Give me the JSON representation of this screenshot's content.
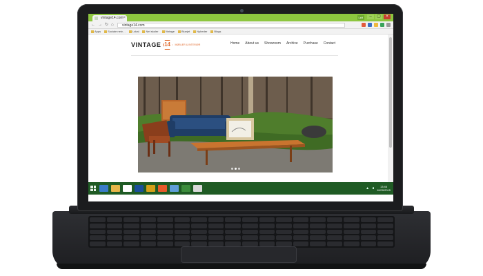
{
  "browser": {
    "tab_title": "vintage14.com",
    "url": "vintage14.com",
    "user_chip": "Leif",
    "min_glyph": "–",
    "max_glyph": "▢",
    "close_glyph": "×",
    "nav": {
      "back": "←",
      "forward": "→",
      "reload": "↻",
      "home": "⌂"
    },
    "bookmarks": [
      "Apps",
      "Sociale netv…",
      "Lokal",
      "Net skoler",
      "Vintage",
      "Bluejet",
      "Nyheder",
      "Blogs"
    ],
    "extension_colors": [
      "#e25b3c",
      "#3b6fc4",
      "#f0b93c",
      "#39a35a",
      "#9a9a9a"
    ]
  },
  "site": {
    "logo_word": "VINTAGE",
    "logo_number": "14",
    "logo_tagline": "MØBLER & INTERIØR",
    "nav": [
      "Home",
      "About us",
      "Showroom",
      "Archive",
      "Purchase",
      "Contact"
    ],
    "hero_dots": 3,
    "hero_active_dot": 1
  },
  "taskbar": {
    "pinned_colors": [
      "#3a7bc8",
      "#e8b64a",
      "#ffffff",
      "#1a4f9a",
      "#d4a019",
      "#e85a2a",
      "#5f9ed8",
      "#3c8d3c",
      "#d9d9d9"
    ],
    "clock_time": "13:46",
    "clock_date": "10/09/2015"
  }
}
